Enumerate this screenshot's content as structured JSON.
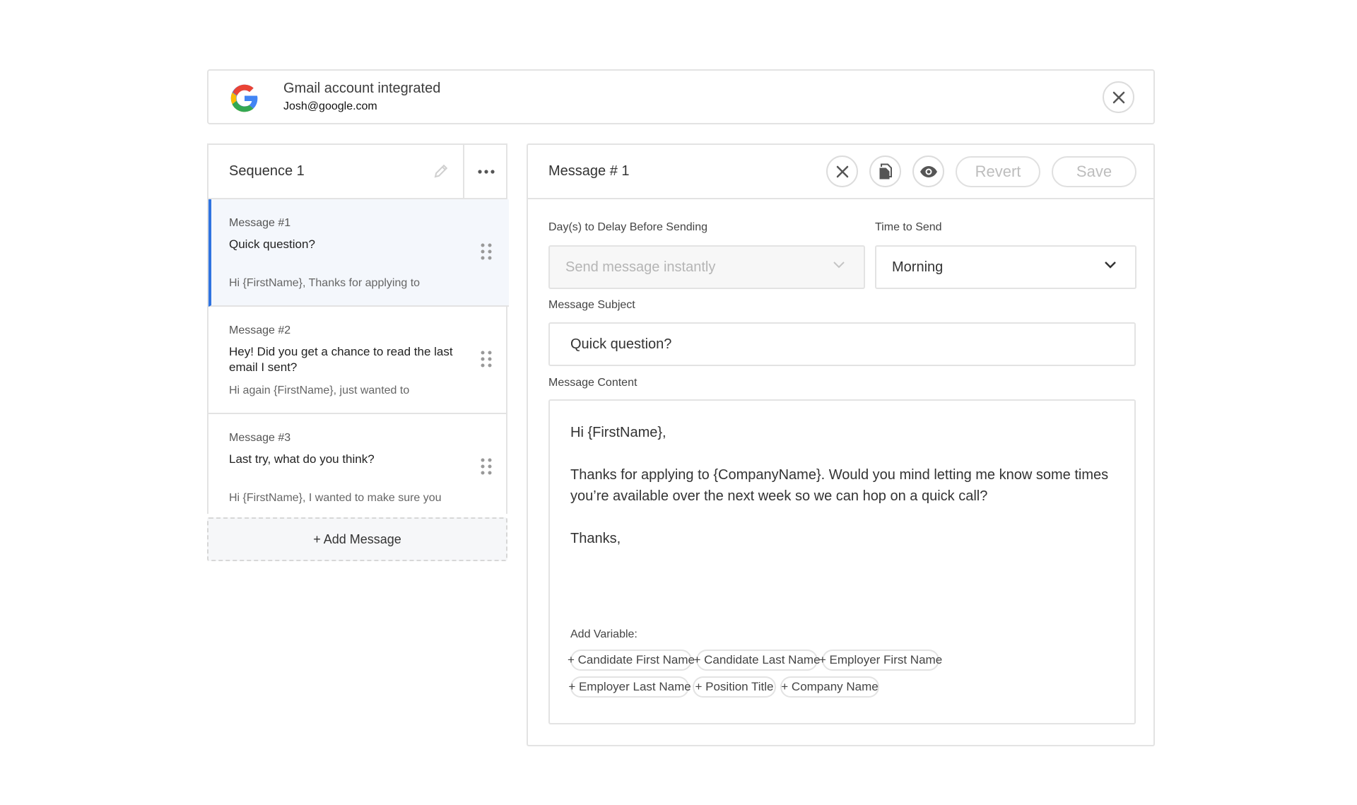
{
  "banner": {
    "title": "Gmail account integrated",
    "email": "Josh@google.com",
    "logo_icon": "google-logo",
    "close_icon": "close-icon"
  },
  "sequence": {
    "title": "Sequence 1",
    "messages": [
      {
        "number": "Message #1",
        "subject": "Quick question?",
        "preview": "Hi {FirstName}, Thanks for applying to",
        "active": true
      },
      {
        "number": "Message #2",
        "subject": "Hey! Did you get a chance to read the last email I sent?",
        "preview": "Hi again {FirstName}, just wanted to",
        "active": false
      },
      {
        "number": "Message #3",
        "subject": "Last try, what do you think?",
        "preview": "Hi {FirstName}, I wanted to make sure you",
        "active": false
      }
    ],
    "add_label": "+ Add Message"
  },
  "editor": {
    "title": "Message # 1",
    "revert_label": "Revert",
    "save_label": "Save",
    "delay_label": "Day(s) to Delay Before Sending",
    "delay_value": "Send message instantly",
    "time_label": "Time to Send",
    "time_value": "Morning",
    "subject_label": "Message Subject",
    "subject_value": "Quick question?",
    "content_label": "Message Content",
    "content_lines": [
      "Hi {FirstName},",
      "Thanks for applying to {CompanyName}. Would you mind letting me know some times you’re available over the next week so we can hop on a quick call?",
      "Thanks,"
    ],
    "variables_label": "Add Variable:",
    "variables": [
      "+ Candidate First Name",
      "+ Candidate Last Name",
      "+ Employer First Name",
      "+ Employer Last Name",
      "+ Position Title",
      "+ Company Name"
    ]
  },
  "colors": {
    "accent": "#2f73e0",
    "border": "#e3e3e3",
    "active_bg": "#f4f7fc"
  }
}
